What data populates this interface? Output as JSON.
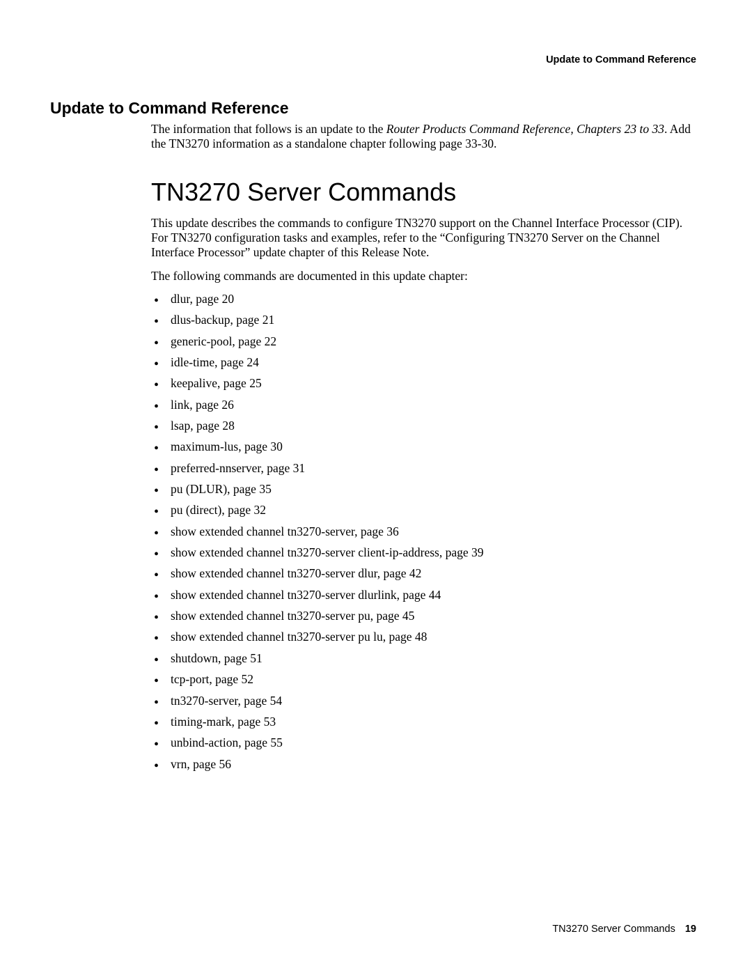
{
  "running_header": "Update to Command Reference",
  "section_heading": "Update to Command Reference",
  "intro": {
    "prefix": "The information that follows is an update to the ",
    "italic": "Router Products Command Reference, Chapters 23 to 33",
    "suffix": ". Add the TN3270 information as a standalone chapter following page 33-30."
  },
  "chapter_title": "TN3270 Server Commands",
  "para1": "This update describes the commands to configure TN3270 support on the Channel Interface Processor (CIP). For TN3270 configuration tasks and examples, refer to the “Configuring TN3270 Server on the Channel Interface Processor” update chapter of this Release Note.",
  "para2": "The following commands are documented in this update chapter:",
  "commands": [
    "dlur, page 20",
    "dlus-backup, page 21",
    "generic-pool, page 22",
    "idle-time, page 24",
    "keepalive, page 25",
    "link, page 26",
    "lsap, page 28",
    "maximum-lus, page 30",
    "preferred-nnserver, page 31",
    "pu (DLUR), page 35",
    "pu (direct), page 32",
    "show extended channel tn3270-server, page 36",
    "show extended channel tn3270-server client-ip-address, page 39",
    "show extended channel tn3270-server dlur, page 42",
    "show extended channel tn3270-server dlurlink, page 44",
    "show extended channel tn3270-server pu, page 45",
    "show extended channel tn3270-server pu lu, page 48",
    "shutdown, page 51",
    "tcp-port, page 52",
    "tn3270-server, page 54",
    "timing-mark, page 53",
    "unbind-action, page 55",
    "vrn, page 56"
  ],
  "footer": {
    "title": "TN3270 Server Commands",
    "page": "19"
  }
}
